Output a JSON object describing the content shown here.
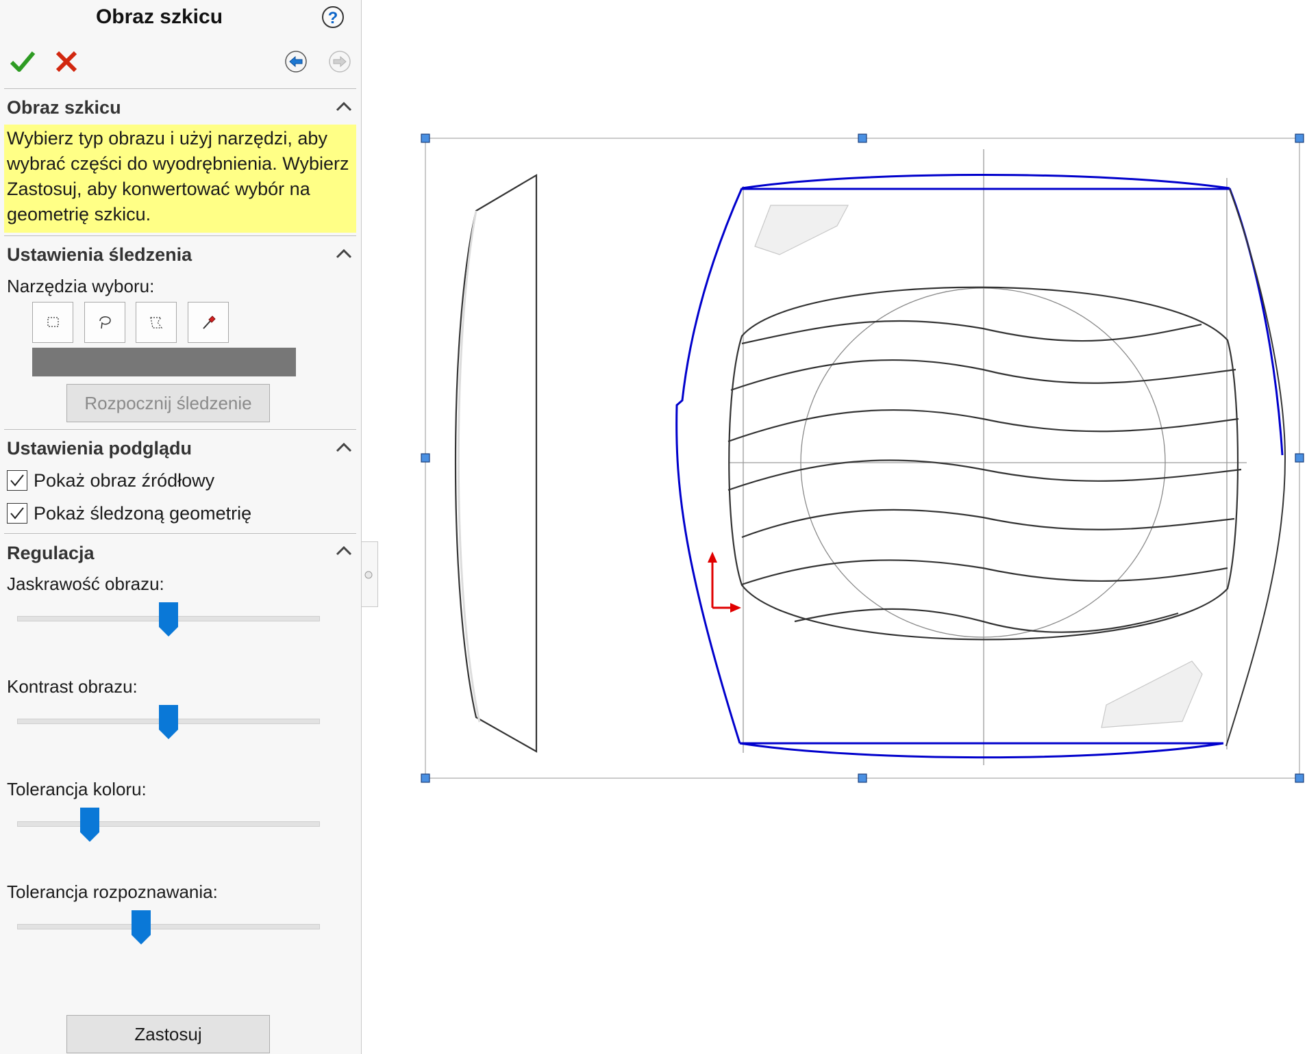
{
  "panel": {
    "title": "Obraz szkicu",
    "help_icon": "?",
    "ok_icon": "checkmark-icon",
    "cancel_icon": "x-icon",
    "back_icon": "arrow-left-icon",
    "forward_icon": "arrow-right-icon"
  },
  "section_image": {
    "header": "Obraz szkicu",
    "message": "Wybierz typ obrazu i użyj narzędzi, aby wybrać części do wyodrębnienia. Wybierz Zastosuj, aby konwertować wybór na geometrię szkicu."
  },
  "section_trace": {
    "header": "Ustawienia śledzenia",
    "tools_label": "Narzędzia wyboru:",
    "tools": [
      "rectangle-select-icon",
      "lasso-select-icon",
      "polygon-select-icon",
      "eyedropper-icon"
    ],
    "selected_color": "#777777",
    "start_button": "Rozpocznij śledzenie"
  },
  "section_preview": {
    "header": "Ustawienia podglądu",
    "show_source": {
      "label": "Pokaż obraz źródłowy",
      "checked": true
    },
    "show_traced": {
      "label": "Pokaż śledzoną geometrię",
      "checked": true
    }
  },
  "section_adjust": {
    "header": "Regulacja",
    "sliders": [
      {
        "label": "Jaskrawość obrazu:",
        "value": 0.5
      },
      {
        "label": "Kontrast obrazu:",
        "value": 0.5
      },
      {
        "label": "Tolerancja koloru:",
        "value": 0.24
      },
      {
        "label": "Tolerancja rozpoznawania:",
        "value": 0.41
      }
    ],
    "apply_button": "Zastosuj"
  },
  "colors": {
    "trace_blue": "#0000cc",
    "handle_fill": "#4a90e2",
    "axis_red": "#e00000",
    "slider_thumb": "#0a78d7",
    "message_bg": "#ffff86"
  }
}
